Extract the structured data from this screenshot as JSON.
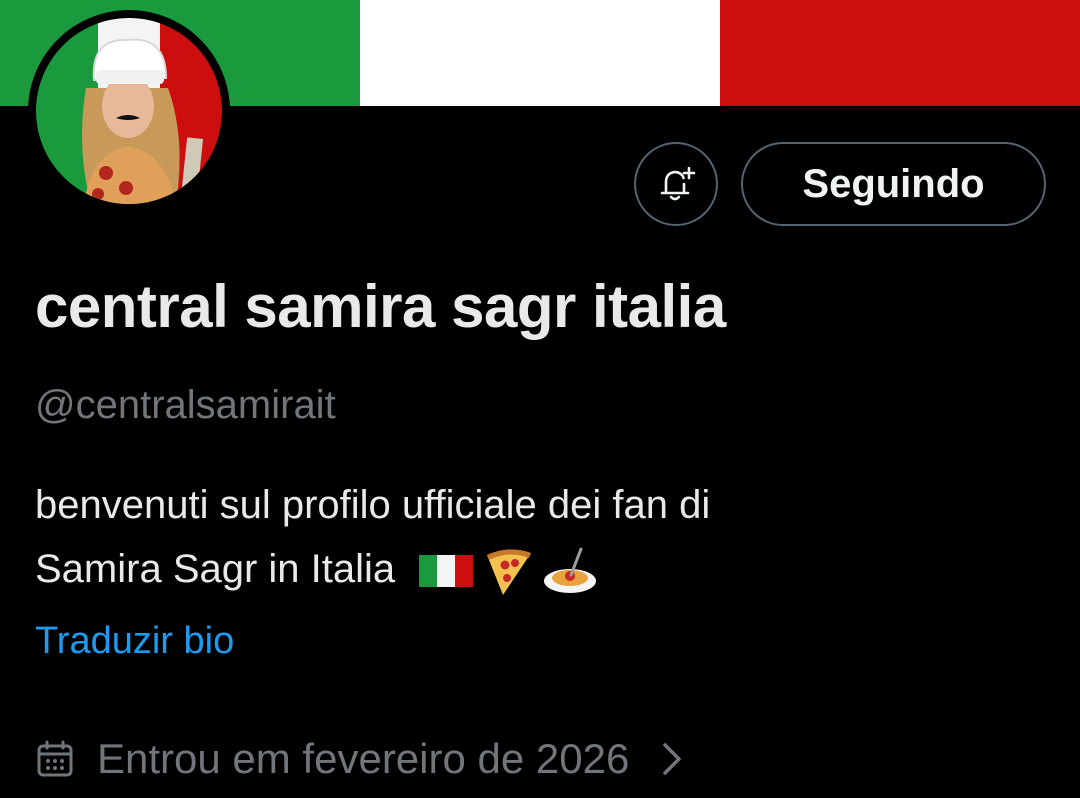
{
  "banner": {
    "colors": [
      "#1a9a3c",
      "#ffffff",
      "#cd0e0e"
    ]
  },
  "profile": {
    "avatar_icon": "avatar-chef-photo",
    "display_name": "central samira sagr italia",
    "handle": "@centralsamirait",
    "bio_line1": "benvenuti sul profilo ufficiale dei fan di",
    "bio_line2": "Samira Sagr in Italia",
    "bio_emojis": [
      "italian-flag-emoji",
      "pizza-emoji",
      "spaghetti-emoji"
    ],
    "translate_label": "Traduzir bio",
    "joined_text": "Entrou em fevereiro de 2026"
  },
  "actions": {
    "notify_icon": "bell-plus-icon",
    "follow_label": "Seguindo"
  },
  "colors": {
    "background": "#000000",
    "primary_text": "#e7e9ea",
    "secondary_text": "#71767b",
    "link": "#1d9bf0",
    "button_border": "#536471"
  }
}
